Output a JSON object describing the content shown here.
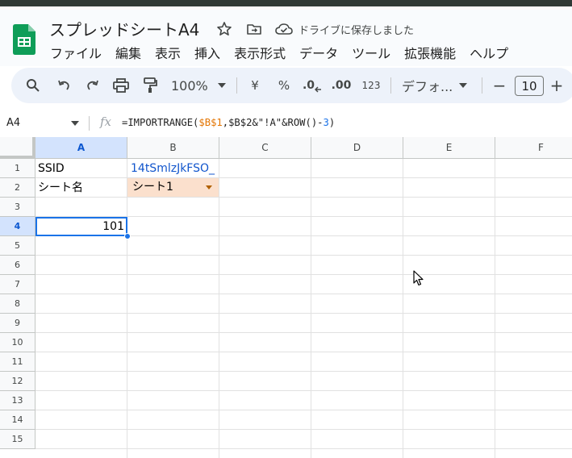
{
  "doc": {
    "title": "スプレッドシートA4",
    "save_status": "ドライブに保存しました"
  },
  "menu": [
    "ファイル",
    "編集",
    "表示",
    "挿入",
    "表示形式",
    "データ",
    "ツール",
    "拡張機能",
    "ヘルプ"
  ],
  "toolbar": {
    "zoom": "100%",
    "currency": "¥",
    "percent": "%",
    "decimal_decrease": ".0",
    "decimal_increase": ".00",
    "number_format": "123",
    "font": "デフォ...",
    "font_size": "10",
    "minus": "−",
    "plus": "+"
  },
  "formula_bar": {
    "name_box": "A4",
    "fx": "fx",
    "formula_parts": [
      "=IMPORTRANGE(",
      "$B$1",
      ",",
      "$B$2",
      "&\"!A\"&ROW()-",
      "3",
      ")"
    ]
  },
  "columns": [
    "A",
    "B",
    "C",
    "D",
    "E",
    "F"
  ],
  "rows": [
    "1",
    "2",
    "3",
    "4",
    "5",
    "6",
    "7",
    "8",
    "9",
    "10",
    "11",
    "12",
    "13",
    "14",
    "15"
  ],
  "cells": {
    "A1": "SSID",
    "B1": "14tSmlzJkFSO_",
    "A2": "シート名",
    "B2": "シート1",
    "A4": "101"
  },
  "colors": {
    "accent": "#1a73e8",
    "link": "#1155cc",
    "chip": "#fbe0cd",
    "header_selected": "#d3e3fd"
  }
}
